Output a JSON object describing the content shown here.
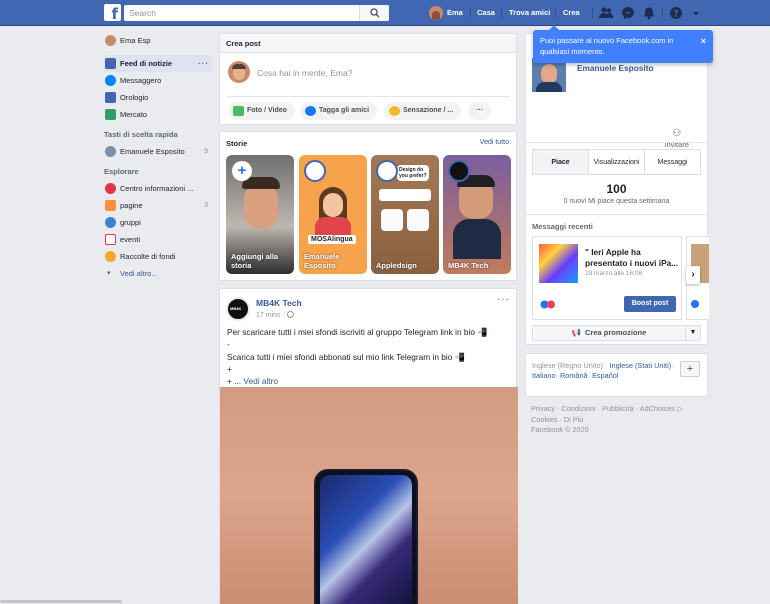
{
  "topbar": {
    "search_placeholder": "Search",
    "user_name": "Ema",
    "nav_home": "Casa",
    "nav_find_friends": "Trova amici",
    "nav_create": "Crea",
    "icons": [
      "friend-requests-icon",
      "messenger-icon",
      "notifications-icon",
      "help-icon",
      "account-menu-icon"
    ]
  },
  "tooltip": {
    "text": "Puoi passare al nuovo Facebook.com in qualsiasi momento.",
    "close": "×"
  },
  "left_nav": {
    "profile": "Ema Esp",
    "items": [
      {
        "label": "Feed di notizie",
        "more": "···"
      },
      {
        "label": "Messaggero"
      },
      {
        "label": "Orologio"
      },
      {
        "label": "Mercato"
      }
    ],
    "shortcuts_heading": "Tasti di scelta rapida",
    "shortcuts": [
      {
        "label": "Emanuele Esposito",
        "count": "9"
      }
    ],
    "explore_heading": "Esplorare",
    "explore": [
      {
        "label": "Centro informazioni ..."
      },
      {
        "label": "pagine",
        "count": "3"
      },
      {
        "label": "gruppi"
      },
      {
        "label": "eventi"
      },
      {
        "label": "Raccolte di fondi"
      }
    ],
    "see_more": "Vedi altro..."
  },
  "composer": {
    "title": "Crea post",
    "placeholder": "Cosa hai in mente, Ema?",
    "actions": [
      "Foto / Video",
      "Tagga gli amici",
      "Sensazione / ...",
      "···"
    ]
  },
  "stories": {
    "title": "Storie",
    "see_all": "Vedi tutto",
    "items": [
      {
        "label": "Aggiungi alla storia"
      },
      {
        "label": "Emanuele Esposito"
      },
      {
        "label": "Appledsign"
      },
      {
        "label": "MB4K Tech"
      }
    ],
    "card_texts": {
      "mosalingua": "MOSAlingua",
      "design": "Design do you prefer?"
    }
  },
  "post": {
    "author": "MB4K Tech",
    "time": "17 mins ·",
    "more": "···",
    "lines": [
      "Per scaricare tutti i miei sfondi iscriviti al gruppo Telegram link in bio 📲",
      "-",
      "Scarica tutti i miei sfondi abbonati sul mio link Telegram in bio 📲",
      "+",
      "+ ..."
    ],
    "see_more": "Vedi altro"
  },
  "page_panel": {
    "name": "Emanuele Esposito",
    "invite": "Invitare",
    "tabs": [
      "Piace",
      "Visualizzazioni",
      "Messaggi"
    ],
    "likes_count": "100",
    "likes_sub": "0 nuovi Mi piace questa settimana",
    "recent_heading": "Messaggi recenti",
    "recent_post_title": "\" Ieri Apple ha presentato i nuovi iPa...",
    "recent_post_date": "19 marzo alle 16:06",
    "boost": "Boost post",
    "create_promo": "Crea promozione"
  },
  "languages": {
    "current": "Inglese (Regno Unito)",
    "others": [
      "Inglese (Stati Uniti)",
      "Italiano",
      "Română",
      "Español"
    ],
    "add": "+"
  },
  "footer": {
    "links": [
      "Privacy",
      "Condizioni",
      "Pubblicità",
      "AdChoices",
      "Cookies",
      "Di Più"
    ],
    "copyright": "Facebook © 2020"
  },
  "colors": {
    "brand": "#4267b2",
    "link": "#385898",
    "tooltip": "#4080ff"
  }
}
